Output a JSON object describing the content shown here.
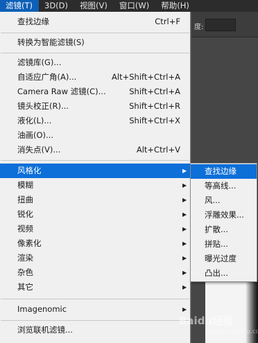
{
  "menubar": {
    "items": [
      "滤镜(T)",
      "3D(D)",
      "视图(V)",
      "窗口(W)",
      "帮助(H)"
    ]
  },
  "options_bar": {
    "label": "度:"
  },
  "filter_menu": {
    "items": [
      {
        "label": "查找边缘",
        "shortcut": "Ctrl+F"
      },
      {
        "label": "转换为智能滤镜(S)"
      },
      {
        "label": "滤镜库(G)..."
      },
      {
        "label": "自适应广角(A)...",
        "shortcut": "Alt+Shift+Ctrl+A"
      },
      {
        "label": "Camera Raw 滤镜(C)...",
        "shortcut": "Shift+Ctrl+A"
      },
      {
        "label": "镜头校正(R)...",
        "shortcut": "Shift+Ctrl+R"
      },
      {
        "label": "液化(L)...",
        "shortcut": "Shift+Ctrl+X"
      },
      {
        "label": "油画(O)..."
      },
      {
        "label": "消失点(V)...",
        "shortcut": "Alt+Ctrl+V"
      },
      {
        "label": "风格化"
      },
      {
        "label": "模糊"
      },
      {
        "label": "扭曲"
      },
      {
        "label": "锐化"
      },
      {
        "label": "视频"
      },
      {
        "label": "像素化"
      },
      {
        "label": "渲染"
      },
      {
        "label": "杂色"
      },
      {
        "label": "其它"
      },
      {
        "label": "Imagenomic"
      },
      {
        "label": "浏览联机滤镜..."
      }
    ]
  },
  "stylize_submenu": {
    "items": [
      "查找边缘",
      "等高线...",
      "风...",
      "浮雕效果...",
      "扩散...",
      "拼贴...",
      "曝光过度",
      "凸出..."
    ]
  },
  "watermark": {
    "text": "Baidu经验",
    "sub": "jingyan.baidu.com"
  }
}
